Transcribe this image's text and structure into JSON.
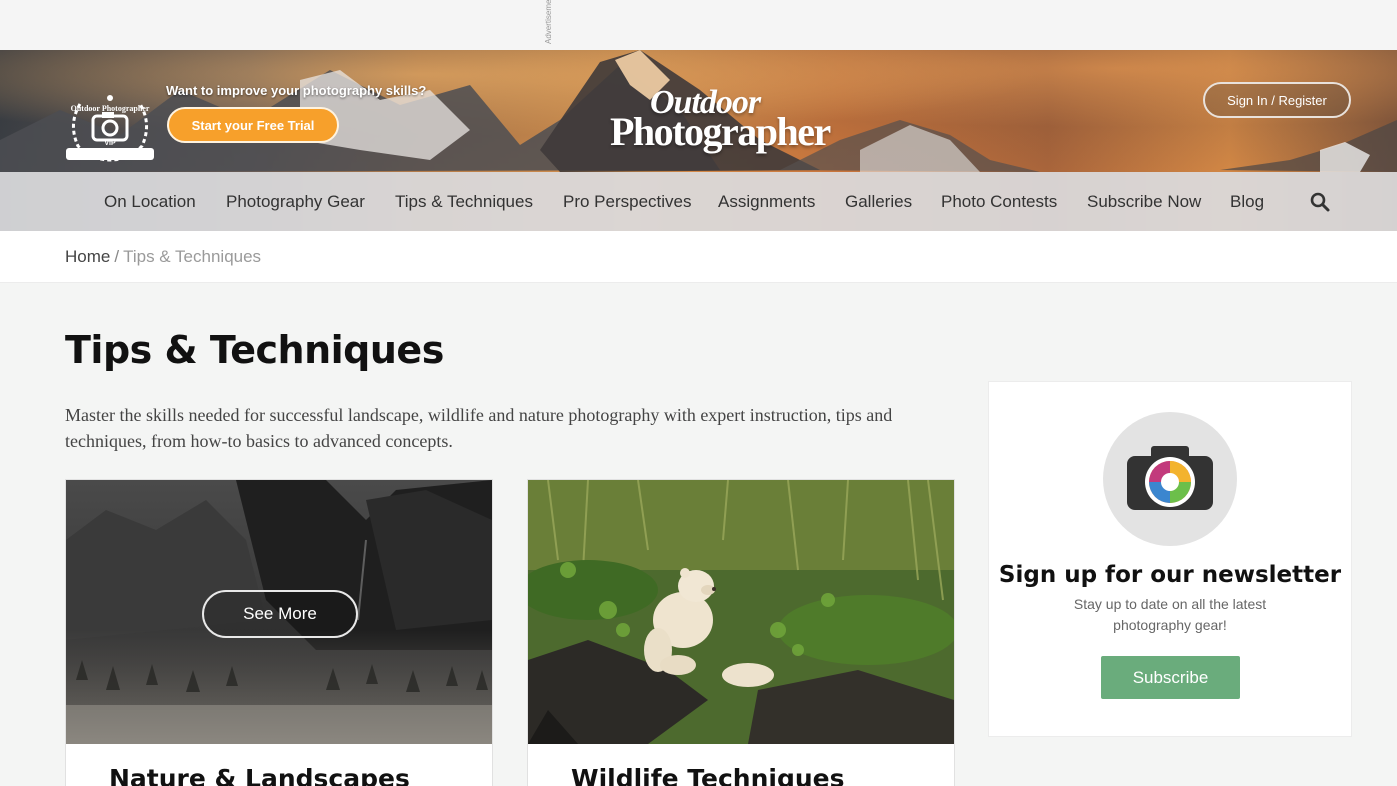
{
  "ad": {
    "label": "Advertisement"
  },
  "header": {
    "badge_text": "Outdoor Photographer",
    "badge_tier": "VIP",
    "promo_text": "Want to improve your photography skills?",
    "trial_label": "Start your Free Trial",
    "logo_line1": "Outdoor",
    "logo_line2": "Photographer",
    "signin_label": "Sign In / Register"
  },
  "nav": {
    "items": [
      {
        "label": "On Location"
      },
      {
        "label": "Photography Gear"
      },
      {
        "label": "Tips & Techniques"
      },
      {
        "label": "Pro Perspectives"
      },
      {
        "label": "Assignments"
      },
      {
        "label": "Galleries"
      },
      {
        "label": "Photo Contests"
      },
      {
        "label": "Subscribe Now"
      },
      {
        "label": "Blog"
      }
    ],
    "search_icon": "search-icon"
  },
  "breadcrumb": {
    "home": "Home",
    "separator": "/",
    "current": "Tips & Techniques"
  },
  "main": {
    "title": "Tips & Techniques",
    "intro": "Master the skills needed for successful landscape, wildlife and nature photography with expert instruction, tips and techniques, from how-to basics to advanced concepts.",
    "cards": [
      {
        "title": "Nature & Landscapes",
        "button": "See More"
      },
      {
        "title": "Wildlife Techniques"
      }
    ]
  },
  "newsletter": {
    "icon": "camera-icon",
    "title": "Sign up for our newsletter",
    "text": "Stay up to date on all the latest photography gear!",
    "button": "Subscribe"
  },
  "colors": {
    "accent_orange": "#f7a02b",
    "subscribe_green": "#6aac7c",
    "nav_bg": "#e2e2e4",
    "page_bg": "#f4f5f4"
  }
}
